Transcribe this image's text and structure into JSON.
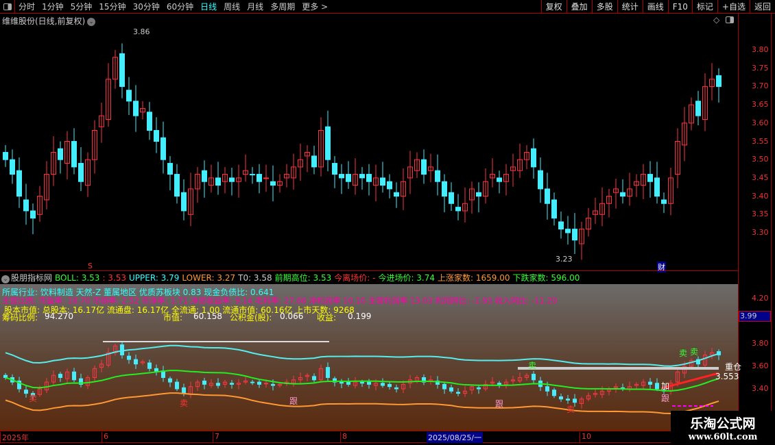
{
  "toolbar": {
    "periods": [
      "分时",
      "1分钟",
      "5分钟",
      "15分钟",
      "30分钟",
      "60分钟",
      "日线",
      "周线",
      "月线",
      "多周期",
      "更多 >"
    ],
    "active": "日线",
    "buttons": [
      "复权",
      "叠加",
      "多股",
      "统计",
      "画线",
      "F10",
      "标记",
      "+自选",
      "返回"
    ]
  },
  "stock_title": "维维股份(日线,前复权)",
  "price_labels": {
    "high": "3.86",
    "low": "3.23"
  },
  "markers": {
    "s": "S",
    "cai": "财"
  },
  "indicator": {
    "name": "股朋指标网",
    "items": [
      {
        "t": "BOLL: 3.53",
        "c": "#3f3"
      },
      {
        "t": ": 3.53",
        "c": "#f33"
      },
      {
        "t": "UPPER: 3.79",
        "c": "#3ff"
      },
      {
        "t": "LOWER: 3.27",
        "c": "#f93"
      },
      {
        "t": "T0: 3.58",
        "c": "#ccc"
      },
      {
        "t": "前期高位: 3.53",
        "c": "#3f3"
      },
      {
        "t": "今离场价: -",
        "c": "#f33"
      },
      {
        "t": "今进场价: 3.74",
        "c": "#3f3"
      },
      {
        "t": "上涨家数: 1659.00",
        "c": "#f93"
      },
      {
        "t": "下跌家数: 596.00",
        "c": "#3f3"
      }
    ]
  },
  "overlay": {
    "line1": "所属行业: 饮料制造 天然-Z 董属地区 优质苏板块 0.83 现金负债比: 0.641",
    "line2": "主营比例: 市盈率: 18.70 市销率: 2.52 市净率: 1.71 净资收益率: 9.14 毛利率: 27.66 净利润率 10.10 主营利润率 13.03 利润同比: -1.93 收入同比: -11.20",
    "line3": "股本市值: 总股本: 16.17亿 流通盘: 16.17亿 全流通: 1.00 流通市值: 60.16亿 上市天数: 9268",
    "line4a": "筹码比例:",
    "line4b": "94.270",
    "line4c": "市值:",
    "line4d": "60.158",
    "line4e": "公积金(股):",
    "line4f": "0.066",
    "line4g": "收益:",
    "line4h": "0.199"
  },
  "lower_signals": {
    "sell": "卖",
    "follow": "跟",
    "add": "加",
    "heavy": "重仓",
    "value": "3.553",
    "current": "3.99"
  },
  "xaxis": {
    "labels": [
      "2025年",
      "6",
      "7",
      "8",
      "10"
    ],
    "cursor": "2025/08/25/一"
  },
  "watermark": {
    "line1": "乐淘公式网",
    "line2": "www.60lt.com"
  },
  "colors": {
    "up": "#ff3344",
    "down": "#44eeff",
    "accent": "#33ffff",
    "frame": "#aa0000"
  },
  "chart_data": {
    "type": "candlestick",
    "upper_yaxis_ticks": [
      "3.80",
      "3.75",
      "3.70",
      "3.65",
      "3.60",
      "3.55",
      "3.50",
      "3.45",
      "3.40",
      "3.35",
      "3.30"
    ],
    "lower_yaxis_ticks": [
      "4.20",
      "3.80",
      "3.60",
      "3.40"
    ],
    "closes": [
      3.5,
      3.46,
      3.4,
      3.36,
      3.34,
      3.4,
      3.46,
      3.52,
      3.5,
      3.55,
      3.48,
      3.44,
      3.5,
      3.58,
      3.62,
      3.72,
      3.78,
      3.7,
      3.66,
      3.62,
      3.64,
      3.58,
      3.55,
      3.5,
      3.46,
      3.4,
      3.36,
      3.42,
      3.46,
      3.44,
      3.45,
      3.43,
      3.46,
      3.44,
      3.45,
      3.47,
      3.46,
      3.44,
      3.45,
      3.43,
      3.44,
      3.46,
      3.48,
      3.5,
      3.52,
      3.48,
      3.58,
      3.5,
      3.46,
      3.45,
      3.44,
      3.46,
      3.45,
      3.44,
      3.45,
      3.43,
      3.42,
      3.4,
      3.44,
      3.48,
      3.5,
      3.46,
      3.48,
      3.44,
      3.4,
      3.38,
      3.36,
      3.38,
      3.42,
      3.4,
      3.44,
      3.46,
      3.44,
      3.46,
      3.48,
      3.5,
      3.52,
      3.48,
      3.42,
      3.38,
      3.34,
      3.31,
      3.3,
      3.28,
      3.31,
      3.34,
      3.36,
      3.38,
      3.4,
      3.42,
      3.4,
      3.42,
      3.44,
      3.46,
      3.44,
      3.4,
      3.38,
      3.45,
      3.55,
      3.6,
      3.65,
      3.62,
      3.7,
      3.72,
      3.7
    ]
  }
}
